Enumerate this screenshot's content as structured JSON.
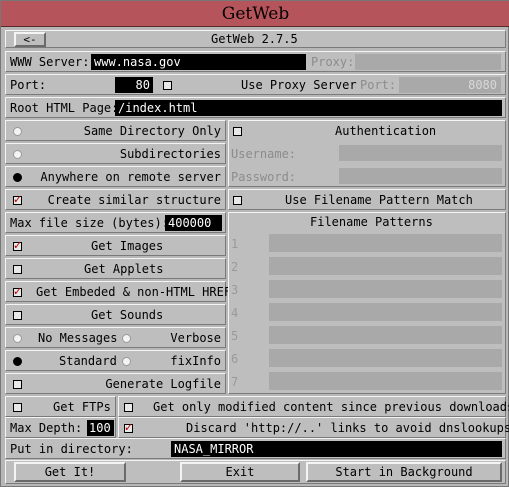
{
  "window": {
    "title": "GetWeb",
    "version": "GetWeb 2.7.5",
    "back_label": "<-"
  },
  "server": {
    "label": "WWW Server:",
    "value": "www.nasa.gov",
    "proxy_label": "Proxy:",
    "proxy_value": ""
  },
  "port": {
    "label": "Port:",
    "value": "80",
    "use_proxy_label": "Use Proxy Server",
    "use_proxy_checked": false,
    "proxy_port_label": "Port:",
    "proxy_port_value": "8080"
  },
  "root": {
    "label": "Root HTML Page:",
    "value": "/index.html"
  },
  "scope": {
    "same_dir": "Same Directory Only",
    "subdirs": "Subdirectories",
    "anywhere": "Anywhere on remote server",
    "selected": "anywhere"
  },
  "auth": {
    "label": "Authentication",
    "checked": false,
    "username_label": "Username:",
    "password_label": "Password:"
  },
  "options": {
    "create_structure": {
      "label": "Create similar structure",
      "checked": true
    },
    "max_file_label": "Max file size (bytes):",
    "max_file_value": "400000",
    "get_images": {
      "label": "Get Images",
      "checked": true
    },
    "get_applets": {
      "label": "Get Applets",
      "checked": false
    },
    "get_embeded": {
      "label": "Get Embeded & non-HTML HREF",
      "checked": true
    },
    "get_sounds": {
      "label": "Get Sounds",
      "checked": false
    }
  },
  "pattern": {
    "use_label": "Use Filename Pattern Match",
    "checked": false,
    "header": "Filename Patterns",
    "numbers": [
      "1",
      "2",
      "3",
      "4",
      "5",
      "6",
      "7"
    ]
  },
  "messages": {
    "no_messages": "No Messages",
    "verbose": "Verbose",
    "standard": "Standard",
    "fixinfo": "fixInfo",
    "selected": "standard"
  },
  "logfile": {
    "label": "Generate Logfile",
    "checked": false
  },
  "ftp": {
    "label": "Get FTPs",
    "checked": false,
    "modified_label": "Get only modified content since previous downloads",
    "modified_checked": false
  },
  "depth": {
    "label": "Max Depth:",
    "value": "100",
    "discard_label": "Discard 'http://..' links to avoid dnslookups",
    "discard_checked": true
  },
  "dir": {
    "label": "Put in directory:",
    "value": "NASA_MIRROR"
  },
  "buttons": {
    "get": "Get It!",
    "exit": "Exit",
    "background": "Start in Background"
  }
}
